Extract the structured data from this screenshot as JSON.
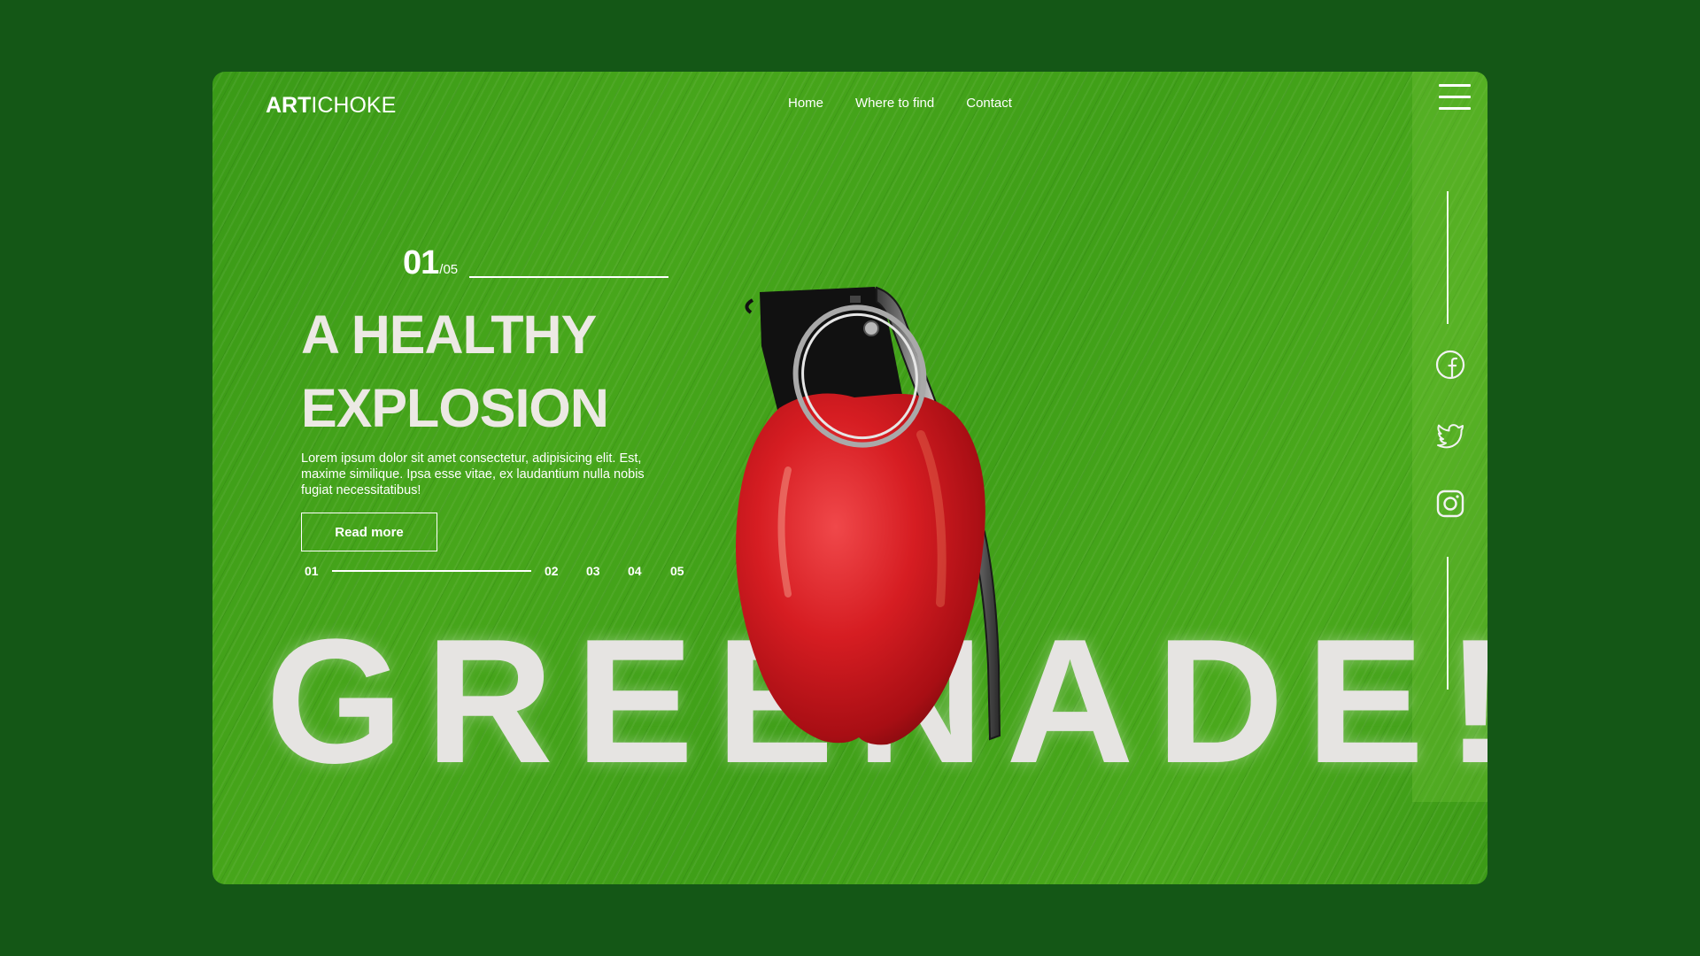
{
  "brand": {
    "logo_bold": "ART",
    "logo_regular": "ICHOKE"
  },
  "nav": {
    "items": [
      "Home",
      "Where to find",
      "Contact"
    ]
  },
  "hero": {
    "slide_current": "01",
    "slide_total": "/05",
    "headline_line1": "A HEALTHY",
    "headline_line2": "EXPLOSION",
    "description": "Lorem ipsum dolor sit amet consectetur, adipisicing elit. Est, maxime similique. Ipsa esse vitae, ex laudantium nulla nobis fugiat necessitatibus!",
    "cta_label": "Read more",
    "big_word": "GREENADE!"
  },
  "pager": {
    "pages": [
      "01",
      "02",
      "03",
      "04",
      "05"
    ],
    "active": "01"
  },
  "social": {
    "icons": [
      "facebook-icon",
      "twitter-icon",
      "instagram-icon"
    ]
  },
  "colors": {
    "page_bg": "#145716",
    "card_green": "#45a51a",
    "text_light": "#ece9e4",
    "apple_red": "#c8141a"
  }
}
